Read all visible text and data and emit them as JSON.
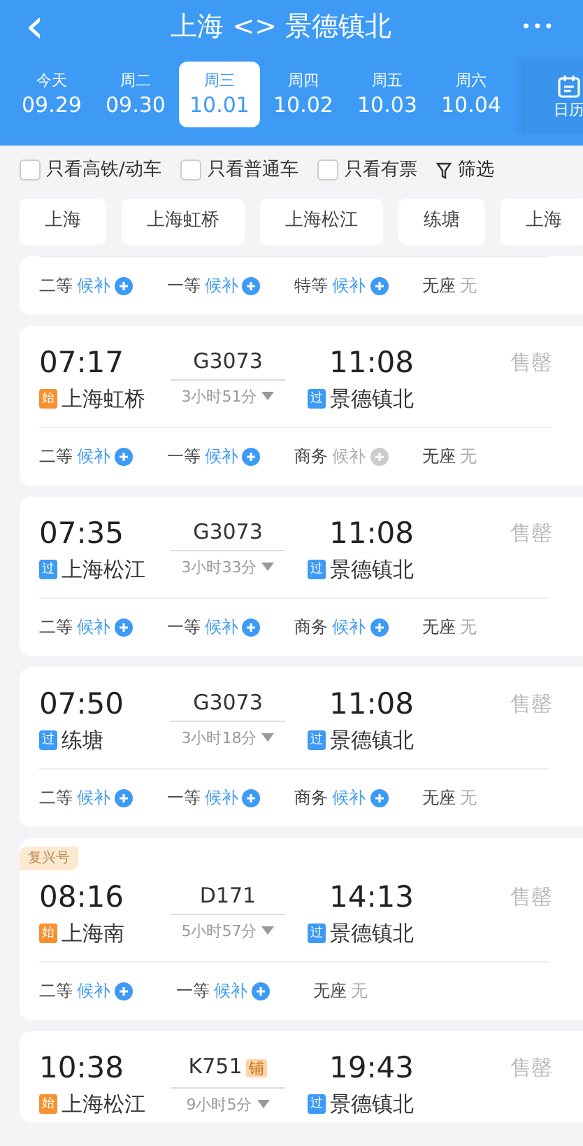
{
  "header": {
    "back": "‹",
    "title": "上海 <> 景德镇北",
    "more": "•••"
  },
  "dates": [
    {
      "weekday": "今天",
      "date": "09.29",
      "selected": false
    },
    {
      "weekday": "周二",
      "date": "09.30",
      "selected": false
    },
    {
      "weekday": "周三",
      "date": "10.01",
      "selected": true
    },
    {
      "weekday": "周四",
      "date": "10.02",
      "selected": false
    },
    {
      "weekday": "周五",
      "date": "10.03",
      "selected": false
    },
    {
      "weekday": "周六",
      "date": "10.04",
      "selected": false
    }
  ],
  "calendar": {
    "label": "日历"
  },
  "filters": [
    {
      "label": "只看高铁/动车",
      "checked": false
    },
    {
      "label": "只看普通车",
      "checked": false
    },
    {
      "label": "只看有票",
      "checked": false
    }
  ],
  "filter_button": "筛选",
  "stations": [
    "上海",
    "上海虹桥",
    "上海松江",
    "练塘",
    "上海"
  ],
  "trains": [
    {
      "seats": [
        {
          "label": "二等",
          "status": "候补",
          "kind": "waitlist",
          "disabled": false
        },
        {
          "label": "一等",
          "status": "候补",
          "kind": "waitlist",
          "disabled": false
        },
        {
          "label": "特等",
          "status": "候补",
          "kind": "waitlist",
          "disabled": false
        },
        {
          "label": "无座",
          "status": "无",
          "kind": "none"
        }
      ]
    },
    {
      "depart": "07:17",
      "train": "G3073",
      "arrive": "11:08",
      "from_tag": {
        "text": "始",
        "kind": "start"
      },
      "from": "上海虹桥",
      "duration": "3小时51分",
      "to_tag": {
        "text": "过",
        "kind": "pass"
      },
      "to": "景德镇北",
      "status": "售罄",
      "seats": [
        {
          "label": "二等",
          "status": "候补",
          "kind": "waitlist",
          "disabled": false
        },
        {
          "label": "一等",
          "status": "候补",
          "kind": "waitlist",
          "disabled": false
        },
        {
          "label": "商务",
          "status": "候补",
          "kind": "waitlist",
          "disabled": true
        },
        {
          "label": "无座",
          "status": "无",
          "kind": "none"
        }
      ]
    },
    {
      "depart": "07:35",
      "train": "G3073",
      "arrive": "11:08",
      "from_tag": {
        "text": "过",
        "kind": "pass"
      },
      "from": "上海松江",
      "duration": "3小时33分",
      "to_tag": {
        "text": "过",
        "kind": "pass"
      },
      "to": "景德镇北",
      "status": "售罄",
      "seats": [
        {
          "label": "二等",
          "status": "候补",
          "kind": "waitlist",
          "disabled": false
        },
        {
          "label": "一等",
          "status": "候补",
          "kind": "waitlist",
          "disabled": false
        },
        {
          "label": "商务",
          "status": "候补",
          "kind": "waitlist",
          "disabled": false
        },
        {
          "label": "无座",
          "status": "无",
          "kind": "none"
        }
      ]
    },
    {
      "depart": "07:50",
      "train": "G3073",
      "arrive": "11:08",
      "from_tag": {
        "text": "过",
        "kind": "pass"
      },
      "from": "练塘",
      "duration": "3小时18分",
      "to_tag": {
        "text": "过",
        "kind": "pass"
      },
      "to": "景德镇北",
      "status": "售罄",
      "seats": [
        {
          "label": "二等",
          "status": "候补",
          "kind": "waitlist",
          "disabled": false
        },
        {
          "label": "一等",
          "status": "候补",
          "kind": "waitlist",
          "disabled": false
        },
        {
          "label": "商务",
          "status": "候补",
          "kind": "waitlist",
          "disabled": false
        },
        {
          "label": "无座",
          "status": "无",
          "kind": "none"
        }
      ]
    },
    {
      "badge": "复兴号",
      "depart": "08:16",
      "train": "D171",
      "arrive": "14:13",
      "from_tag": {
        "text": "始",
        "kind": "start"
      },
      "from": "上海南",
      "duration": "5小时57分",
      "to_tag": {
        "text": "过",
        "kind": "pass"
      },
      "to": "景德镇北",
      "status": "售罄",
      "seats": [
        {
          "label": "二等",
          "status": "候补",
          "kind": "waitlist",
          "disabled": false
        },
        {
          "label": "一等",
          "status": "候补",
          "kind": "waitlist",
          "disabled": false
        },
        {
          "label": "无座",
          "status": "无",
          "kind": "none"
        }
      ]
    },
    {
      "depart": "10:38",
      "train": "K751",
      "train_tag": "铺",
      "arrive": "19:43",
      "from_tag": {
        "text": "始",
        "kind": "start"
      },
      "from": "上海松江",
      "duration": "9小时5分",
      "to_tag": {
        "text": "过",
        "kind": "pass"
      },
      "to": "景德镇北",
      "status": "售罄"
    }
  ]
}
